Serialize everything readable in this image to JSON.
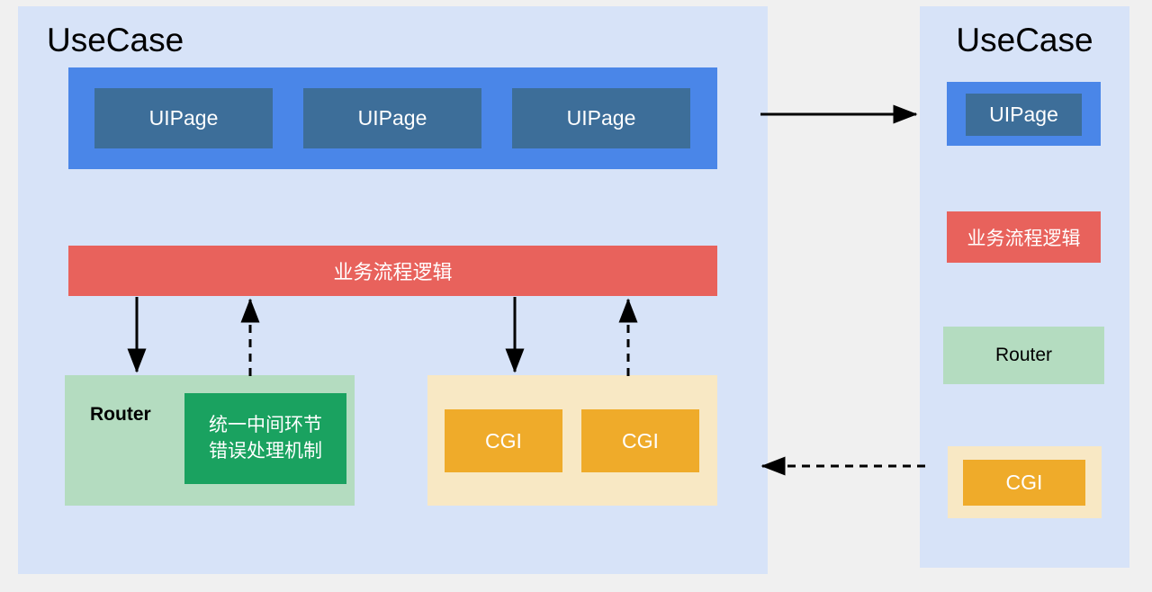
{
  "diagram": {
    "background_color": "#f0f0f0",
    "panel_color": "#d7e3f8"
  },
  "left_panel": {
    "title": "UseCase",
    "ui_group": {
      "color": "#4a86e8",
      "pages": [
        {
          "label": "UIPage",
          "color": "#3d6e99"
        },
        {
          "label": "UIPage",
          "color": "#3d6e99"
        },
        {
          "label": "UIPage",
          "color": "#3d6e99"
        }
      ]
    },
    "flow_bar": {
      "label": "业务流程逻辑",
      "color": "#e8625c"
    },
    "router_group": {
      "label": "Router",
      "color": "#b4dcc0",
      "inner": {
        "line1": "统一中间环节",
        "line2": "错误处理机制",
        "color": "#1aa260"
      }
    },
    "cgi_group": {
      "color": "#f8e8c4",
      "items": [
        {
          "label": "CGI",
          "color": "#efab2a"
        },
        {
          "label": "CGI",
          "color": "#efab2a"
        }
      ]
    }
  },
  "right_panel": {
    "title": "UseCase",
    "ui_group": {
      "color": "#4a86e8",
      "pages": [
        {
          "label": "UIPage",
          "color": "#3d6e99"
        }
      ]
    },
    "flow_bar": {
      "label": "业务流程逻辑",
      "color": "#e8625c"
    },
    "router_box": {
      "label": "Router",
      "color": "#b4dcc0"
    },
    "cgi_group": {
      "color": "#f8e8c4",
      "items": [
        {
          "label": "CGI",
          "color": "#efab2a"
        }
      ]
    }
  },
  "connectors": {
    "color": "#000000",
    "panel_top": {
      "style": "solid",
      "direction": "right"
    },
    "panel_bottom": {
      "style": "dashed",
      "direction": "left"
    },
    "flow_to_router": {
      "style": "solid",
      "direction": "down"
    },
    "router_to_flow": {
      "style": "dashed",
      "direction": "up"
    },
    "flow_to_cgi": {
      "style": "solid",
      "direction": "down"
    },
    "cgi_to_flow": {
      "style": "dashed",
      "direction": "up"
    }
  }
}
